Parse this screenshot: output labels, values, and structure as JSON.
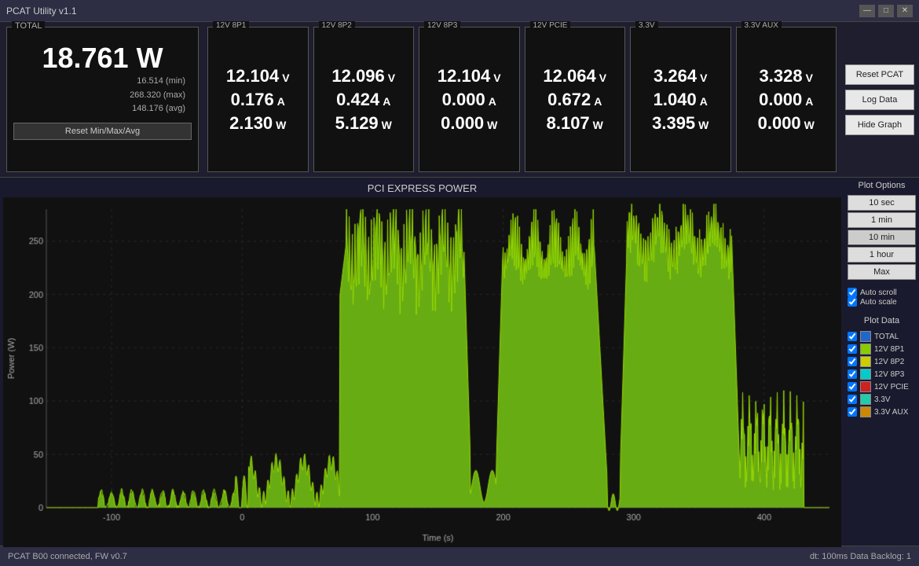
{
  "titlebar": {
    "title": "PCAT Utility v1.1",
    "min": "—",
    "max": "□",
    "close": "✕"
  },
  "total": {
    "label": "TOTAL",
    "watts": "18.761 W",
    "min": "16.514 (min)",
    "max": "268.320 (max)",
    "avg": "148.176 (avg)",
    "reset_btn": "Reset Min/Max/Avg"
  },
  "panels": [
    {
      "label": "12V 8P1",
      "voltage": "12.104",
      "voltage_unit": "V",
      "current": "0.176",
      "current_unit": "A",
      "power": "2.130",
      "power_unit": "W"
    },
    {
      "label": "12V 8P2",
      "voltage": "12.096",
      "voltage_unit": "V",
      "current": "0.424",
      "current_unit": "A",
      "power": "5.129",
      "power_unit": "W"
    },
    {
      "label": "12V 8P3",
      "voltage": "12.104",
      "voltage_unit": "V",
      "current": "0.000",
      "current_unit": "A",
      "power": "0.000",
      "power_unit": "W"
    },
    {
      "label": "12V PCIE",
      "voltage": "12.064",
      "voltage_unit": "V",
      "current": "0.672",
      "current_unit": "A",
      "power": "8.107",
      "power_unit": "W"
    },
    {
      "label": "3.3V",
      "voltage": "3.264",
      "voltage_unit": "V",
      "current": "1.040",
      "current_unit": "A",
      "power": "3.395",
      "power_unit": "W"
    },
    {
      "label": "3.3V AUX",
      "voltage": "3.328",
      "voltage_unit": "V",
      "current": "0.000",
      "current_unit": "A",
      "power": "0.000",
      "power_unit": "W"
    }
  ],
  "action_buttons": [
    "Reset PCAT",
    "Log Data",
    "Hide Graph"
  ],
  "graph": {
    "title": "PCI EXPRESS POWER",
    "y_label": "Power (W)",
    "x_label": "Time (s)",
    "y_ticks": [
      "250",
      "200",
      "150",
      "100",
      "50",
      "0"
    ],
    "x_ticks": [
      "-100",
      "0",
      "100",
      "200",
      "300",
      "400"
    ]
  },
  "plot_options": {
    "label": "Plot Options",
    "buttons": [
      "10 sec",
      "1 min",
      "10 min",
      "1 hour",
      "Max"
    ],
    "active_btn": "10 min",
    "auto_scroll": true,
    "auto_scale": true,
    "auto_scroll_label": "Auto scroll",
    "auto_scale_label": "Auto scale"
  },
  "plot_data": {
    "label": "Plot Data",
    "items": [
      {
        "name": "TOTAL",
        "color": "#2266cc",
        "checked": true
      },
      {
        "name": "12V 8P1",
        "color": "#88cc00",
        "checked": true
      },
      {
        "name": "12V 8P2",
        "color": "#cccc00",
        "checked": true
      },
      {
        "name": "12V 8P3",
        "color": "#00cccc",
        "checked": true
      },
      {
        "name": "12V PCIE",
        "color": "#cc2222",
        "checked": true
      },
      {
        "name": "3.3V",
        "color": "#22ccaa",
        "checked": true
      },
      {
        "name": "3.3V AUX",
        "color": "#cc8800",
        "checked": true
      }
    ]
  },
  "statusbar": {
    "left": "PCAT B00 connected, FW v0.7",
    "right": "dt: 100ms   Data Backlog: 1"
  }
}
